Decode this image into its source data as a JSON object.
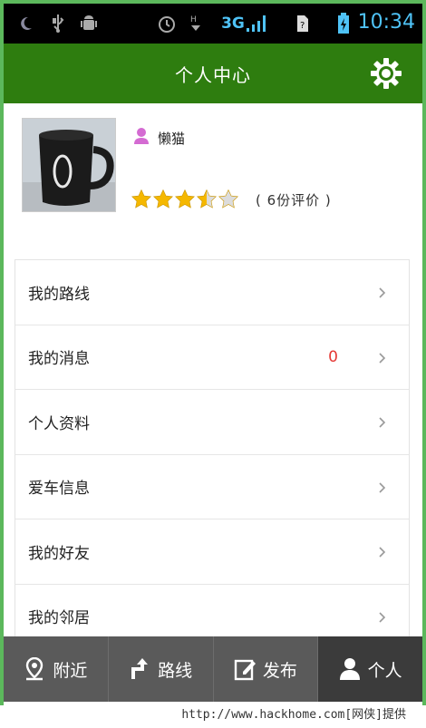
{
  "status_bar": {
    "network": "3G",
    "time": "10:34",
    "icons": [
      "moon-icon",
      "usb-icon",
      "android-debug-icon",
      "alarm-icon",
      "data-transfer-icon",
      "signal-icon",
      "sim-icon",
      "battery-icon"
    ]
  },
  "header": {
    "title": "个人中心",
    "settings_icon": "gear-icon"
  },
  "profile": {
    "username": "懒猫",
    "user_icon": "user-pink-icon",
    "rating": 3.5,
    "rating_max": 5,
    "rating_text": "( 6份评价 )"
  },
  "menu": [
    {
      "label": "我的路线",
      "count": ""
    },
    {
      "label": "我的消息",
      "count": "0"
    },
    {
      "label": "个人资料",
      "count": ""
    },
    {
      "label": "爱车信息",
      "count": ""
    },
    {
      "label": "我的好友",
      "count": ""
    },
    {
      "label": "我的邻居",
      "count": ""
    }
  ],
  "bottom_nav": [
    {
      "label": "附近",
      "icon": "location-pin-icon",
      "active": false
    },
    {
      "label": "路线",
      "icon": "route-arrow-icon",
      "active": false
    },
    {
      "label": "发布",
      "icon": "edit-icon",
      "active": false
    },
    {
      "label": "个人",
      "icon": "person-icon",
      "active": true
    }
  ],
  "watermark": "http://www.hackhome.com[网侠]提供",
  "colors": {
    "header_bg": "#2e7d0f",
    "count_red": "#e53935",
    "star_gold": "#f5b800",
    "nav_bg": "#5a5a5a",
    "nav_active_bg": "#3b3b3b"
  }
}
